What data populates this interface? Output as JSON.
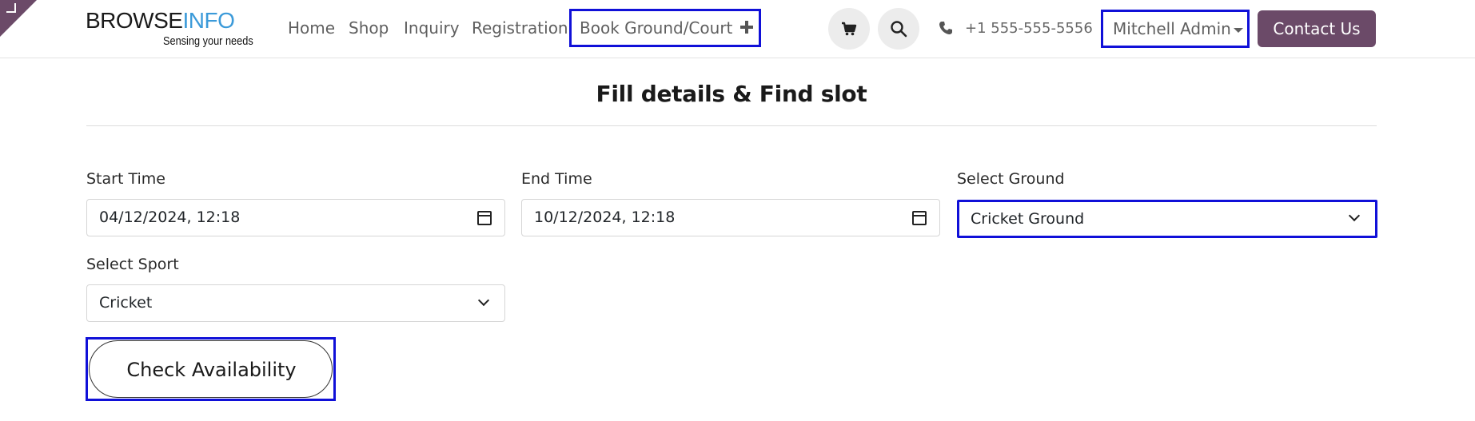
{
  "header": {
    "logo_main_a": "BROWSE",
    "logo_main_b": "INFO",
    "logo_tagline": "Sensing your needs",
    "nav": [
      {
        "label": "Home"
      },
      {
        "label": "Shop"
      },
      {
        "label": "Inquiry"
      },
      {
        "label": "Registration"
      }
    ],
    "book_label": "Book Ground/Court",
    "cart_icon": "cart-icon",
    "search_icon": "search-icon",
    "phone": "+1 555-555-5556",
    "user": "Mitchell Admin",
    "contact_label": "Contact Us",
    "colors": {
      "brand": "#6b4a68",
      "highlight": "#1010d8",
      "logo_blue": "#3b9ad9"
    }
  },
  "form": {
    "title": "Fill details & Find slot",
    "start_time": {
      "label": "Start Time",
      "value": "04/12/2024, 12:18"
    },
    "end_time": {
      "label": "End Time",
      "value": "10/12/2024, 12:18"
    },
    "ground": {
      "label": "Select Ground",
      "value": "Cricket Ground"
    },
    "sport": {
      "label": "Select Sport",
      "value": "Cricket"
    },
    "check_label": "Check Availability"
  }
}
